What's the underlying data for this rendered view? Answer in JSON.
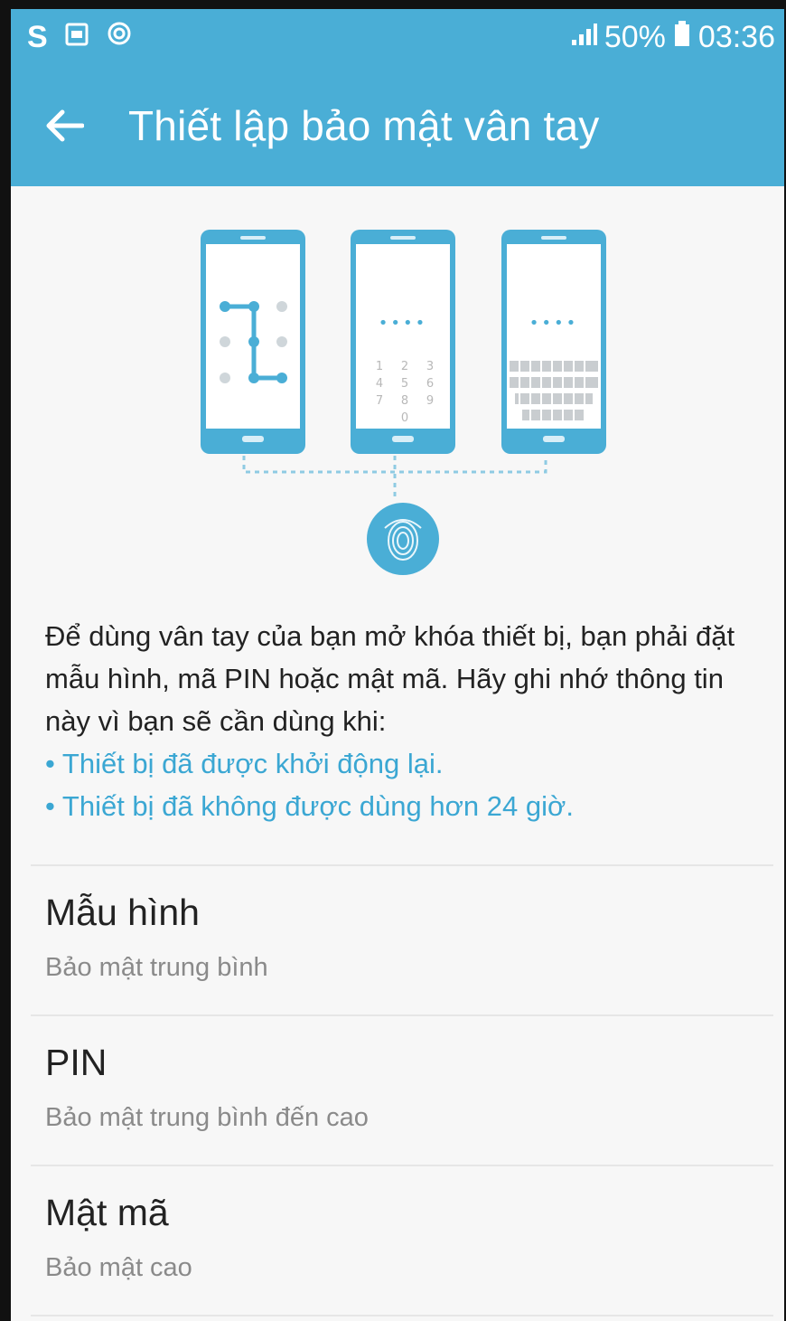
{
  "status_bar": {
    "left_icons": [
      "s-icon",
      "gallery-icon",
      "sync-icon"
    ],
    "s_label": "S",
    "signal": "50%",
    "time": "03:36"
  },
  "app_bar": {
    "back_icon": "back-arrow-icon",
    "title": "Thiết lập bảo mật vân tay"
  },
  "illustration": {
    "pin_keys": [
      "1",
      "2",
      "3",
      "4",
      "5",
      "6",
      "7",
      "8",
      "9",
      "0"
    ],
    "masked": "••••",
    "fingerprint_icon": "fingerprint-icon"
  },
  "intro": {
    "line1": "Để dùng vân tay của bạn mở khóa thiết bị, bạn phải đặt mẫu hình, mã PIN hoặc mật mã. Hãy ghi nhớ thông tin này vì bạn sẽ cần dùng khi:",
    "bullet1": "• Thiết bị đã được khởi động lại.",
    "bullet2": "• Thiết bị đã không được dùng hơn 24 giờ."
  },
  "options": [
    {
      "title": "Mẫu hình",
      "subtitle": "Bảo mật trung bình"
    },
    {
      "title": "PIN",
      "subtitle": "Bảo mật trung bình đến cao"
    },
    {
      "title": "Mật mã",
      "subtitle": "Bảo mật cao"
    }
  ],
  "colors": {
    "accent": "#4aaed6",
    "link": "#3ba7d3",
    "background": "#f7f7f7"
  }
}
